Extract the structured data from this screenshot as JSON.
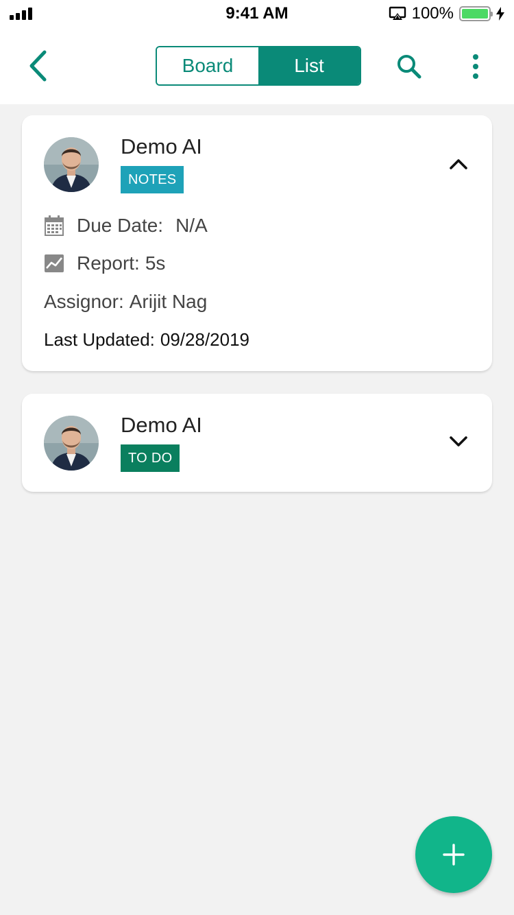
{
  "status_bar": {
    "time": "9:41 AM",
    "battery_percent": "100%",
    "battery_level": 1.0,
    "icons": [
      "signal-icon",
      "airplay-icon",
      "battery-icon",
      "charging-bolt-icon"
    ]
  },
  "nav": {
    "back_icon": "chevron-left-icon",
    "segments": {
      "board": "Board",
      "list": "List"
    },
    "active_segment": "List",
    "search_icon": "search-icon",
    "more_icon": "more-vertical-icon"
  },
  "colors": {
    "accent": "#0a8a78",
    "notes_badge": "#1ea2b8",
    "todo_badge": "#0a7f5e",
    "fab": "#11b58a",
    "background": "#f2f2f2"
  },
  "cards": [
    {
      "title": "Demo AI",
      "badge": "NOTES",
      "expanded": true,
      "chevron_icon": "chevron-up-icon",
      "due_label": "Due Date:",
      "due_value": "N/A",
      "report_label": "Report:",
      "report_value": "5s",
      "assignor_label": "Assignor:",
      "assignor_value": "Arijit Nag",
      "updated_label": "Last Updated:",
      "updated_value": "09/28/2019"
    },
    {
      "title": "Demo AI",
      "badge": "TO DO",
      "expanded": false,
      "chevron_icon": "chevron-down-icon"
    }
  ],
  "fab": {
    "icon": "plus-icon"
  }
}
